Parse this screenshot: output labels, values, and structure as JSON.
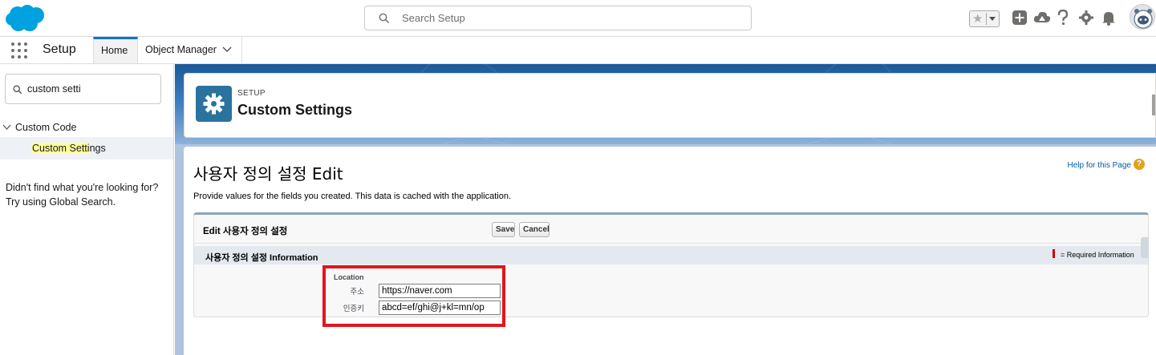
{
  "header": {
    "search_placeholder": "Search Setup",
    "brand_color": "#00a1e0"
  },
  "context_nav": {
    "app_name": "Setup",
    "tabs": [
      {
        "label": "Home",
        "active": true
      },
      {
        "label": "Object Manager",
        "has_dropdown": true
      }
    ]
  },
  "sidebar": {
    "quick_find_value": "custom setti",
    "tree": {
      "parent_label": "Custom Code",
      "child_label_highlight": "Custom Setti",
      "child_label_rest": "ngs"
    },
    "help_line1": "Didn't find what you're looking for?",
    "help_line2": "Try using Global Search."
  },
  "setup_header": {
    "eyebrow": "SETUP",
    "title": "Custom Settings"
  },
  "page": {
    "title": "사용자 정의 설정 Edit",
    "help_link": "Help for this Page",
    "help_icon_glyph": "?",
    "description": "Provide values for the fields you created. This data is cached with the application."
  },
  "edit_block": {
    "title": "Edit 사용자 정의 설정",
    "save_label": "Save",
    "cancel_label": "Cancel",
    "section_title": "사용자 정의 설정 Information",
    "required_text": "= Required Information",
    "group_label": "Location",
    "fields": [
      {
        "label": "주소",
        "value": "https://naver.com"
      },
      {
        "label": "인증키",
        "value": "abcd=ef/ghi@j+kl=mn/op"
      }
    ],
    "highlight_color": "#e0161e"
  }
}
